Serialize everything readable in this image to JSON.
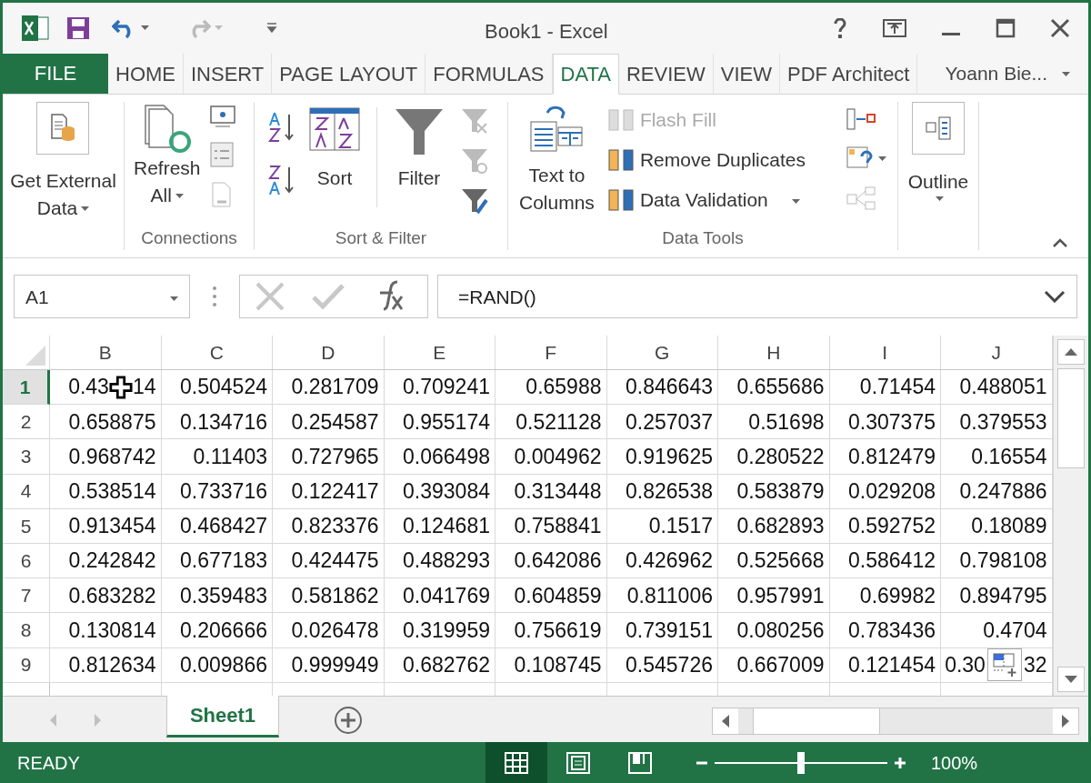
{
  "window": {
    "title": "Book1 - Excel"
  },
  "quick_access": [
    {
      "kind": "save"
    },
    {
      "kind": "undo"
    },
    {
      "kind": "redo"
    },
    {
      "kind": "customize"
    }
  ],
  "ribbon_tabs": [
    {
      "label": "FILE",
      "kind": "file",
      "selected": false
    },
    {
      "label": "HOME",
      "kind": "tab",
      "selected": false
    },
    {
      "label": "INSERT",
      "kind": "tab",
      "selected": false
    },
    {
      "label": "PAGE LAYOUT",
      "kind": "tab",
      "selected": false
    },
    {
      "label": "FORMULAS",
      "kind": "tab",
      "selected": false
    },
    {
      "label": "DATA",
      "kind": "tab",
      "selected": true
    },
    {
      "label": "REVIEW",
      "kind": "tab",
      "selected": false
    },
    {
      "label": "VIEW",
      "kind": "tab",
      "selected": false
    },
    {
      "label": "PDF Architect",
      "kind": "tab",
      "selected": false
    }
  ],
  "user": {
    "name": "Yoann Bie..."
  },
  "ribbon": {
    "get_external": {
      "line1": "Get External",
      "line2": "Data"
    },
    "connections": {
      "label": "Connections",
      "refresh_line1": "Refresh",
      "refresh_line2": "All"
    },
    "sort_filter": {
      "label": "Sort & Filter",
      "sort": "Sort",
      "filter": "Filter"
    },
    "data_tools": {
      "label": "Data Tools",
      "text_to_columns_line1": "Text to",
      "text_to_columns_line2": "Columns",
      "items": [
        {
          "label": "Flash Fill",
          "disabled": true,
          "dropdown": false
        },
        {
          "label": "Remove Duplicates",
          "disabled": false,
          "dropdown": false
        },
        {
          "label": "Data Validation",
          "disabled": false,
          "dropdown": true
        }
      ]
    },
    "outline": {
      "label": "Outline"
    }
  },
  "formula_bar": {
    "name_box": "A1",
    "formula": "=RAND()"
  },
  "columns": [
    "B",
    "C",
    "D",
    "E",
    "F",
    "G",
    "H",
    "I",
    "J"
  ],
  "rows": [
    {
      "header": "1",
      "selected": true,
      "cells": [
        {
          "kind": "covered",
          "before": "0.43",
          "after": "14",
          "overlay": {
            "kind": "cursor"
          }
        },
        "0.504524",
        "0.281709",
        "0.709241",
        "0.65988",
        "0.846643",
        "0.655686",
        "0.71454",
        "0.488051"
      ]
    },
    {
      "header": "2",
      "selected": false,
      "cells": [
        "0.658875",
        "0.134716",
        "0.254587",
        "0.955174",
        "0.521128",
        "0.257037",
        "0.51698",
        "0.307375",
        "0.379553"
      ]
    },
    {
      "header": "3",
      "selected": false,
      "cells": [
        "0.968742",
        "0.11403",
        "0.727965",
        "0.066498",
        "0.004962",
        "0.919625",
        "0.280522",
        "0.812479",
        "0.16554"
      ]
    },
    {
      "header": "4",
      "selected": false,
      "cells": [
        "0.538514",
        "0.733716",
        "0.122417",
        "0.393084",
        "0.313448",
        "0.826538",
        "0.583879",
        "0.029208",
        "0.247886"
      ]
    },
    {
      "header": "5",
      "selected": false,
      "cells": [
        "0.913454",
        "0.468427",
        "0.823376",
        "0.124681",
        "0.758841",
        "0.1517",
        "0.682893",
        "0.592752",
        "0.18089"
      ]
    },
    {
      "header": "6",
      "selected": false,
      "cells": [
        "0.242842",
        "0.677183",
        "0.424475",
        "0.488293",
        "0.642086",
        "0.426962",
        "0.525668",
        "0.586412",
        "0.798108"
      ]
    },
    {
      "header": "7",
      "selected": false,
      "cells": [
        "0.683282",
        "0.359483",
        "0.581862",
        "0.041769",
        "0.604859",
        "0.811006",
        "0.957991",
        "0.69982",
        "0.894795"
      ]
    },
    {
      "header": "8",
      "selected": false,
      "cells": [
        "0.130814",
        "0.206666",
        "0.026478",
        "0.319959",
        "0.756619",
        "0.739151",
        "0.080256",
        "0.783436",
        "0.4704"
      ]
    },
    {
      "header": "9",
      "selected": false,
      "cells": [
        "0.812634",
        "0.009866",
        "0.999949",
        "0.682762",
        "0.108745",
        "0.545726",
        "0.667009",
        "0.121454",
        {
          "kind": "covered",
          "before": "0.30",
          "after": "32",
          "overlay": {
            "kind": "paste-options"
          }
        }
      ]
    }
  ],
  "sheet_tabs": [
    {
      "label": "Sheet1",
      "selected": true
    }
  ],
  "status_bar": {
    "status": "READY",
    "views": [
      {
        "kind": "normal",
        "selected": true
      },
      {
        "kind": "page-layout",
        "selected": false
      },
      {
        "kind": "page-break",
        "selected": false
      }
    ],
    "zoom": {
      "level": 0.5,
      "reading": "100%"
    }
  }
}
